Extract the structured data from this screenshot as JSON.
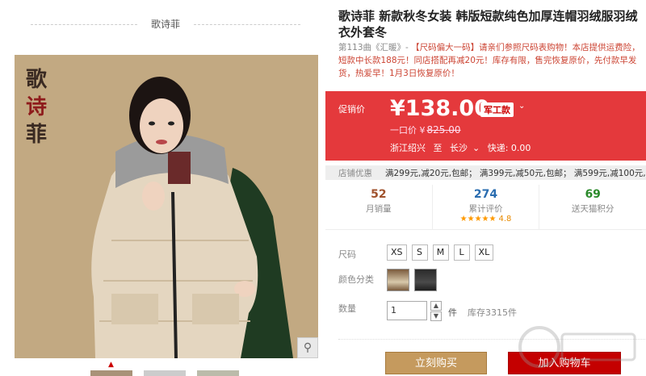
{
  "store": {
    "name": "歌诗菲",
    "logo_text": [
      "歌",
      "诗",
      "菲"
    ]
  },
  "product": {
    "title": "歌诗菲 新款秋冬女装 韩版短款纯色加厚连帽羽绒服羽绒衣外套冬",
    "subtitle_gray": "第113曲《汇暖》- ",
    "subtitle": "【尺码偏大一码】请亲们参照尺码表购物！本店提供运费险，短款中长款188元！同店搭配再减20元！库存有限，售完恢复原价，先付款早发货，热爱早！1月3日恢复原价！"
  },
  "price": {
    "label": "促销价",
    "value": "¥138.00",
    "badge": "军工款",
    "orig_label": "一口价 ¥",
    "orig_value": "825.00",
    "ship_from": "浙江绍兴",
    "ship_to_word": "至",
    "ship_to": "长沙",
    "ship_fee": "快递: 0.00"
  },
  "promo": {
    "label": "店铺优惠",
    "text": "满299元,减20元,包邮； 满399元,减50元,包邮； 满599元,减100元,包"
  },
  "stats": [
    {
      "num": "52",
      "label": "月销量",
      "color": "#a0522d"
    },
    {
      "num": "274",
      "label": "累计评价",
      "color": "#2a6db0",
      "stars": "★★★★★",
      "rating": "4.8"
    },
    {
      "num": "69",
      "label": "送天猫积分",
      "color": "#2b8a2b"
    }
  ],
  "options": {
    "size_label": "尺码",
    "sizes": [
      "XS",
      "S",
      "M",
      "L",
      "XL"
    ],
    "color_label": "颜色分类",
    "qty_label": "数量",
    "qty_value": "1",
    "unit": "件",
    "stock": "库存3315件"
  },
  "buttons": {
    "buy": "立刻购买",
    "cart": "加入购物车"
  },
  "icons": {
    "zoom": "magnifier-icon",
    "caret": "chevron-down-icon"
  }
}
